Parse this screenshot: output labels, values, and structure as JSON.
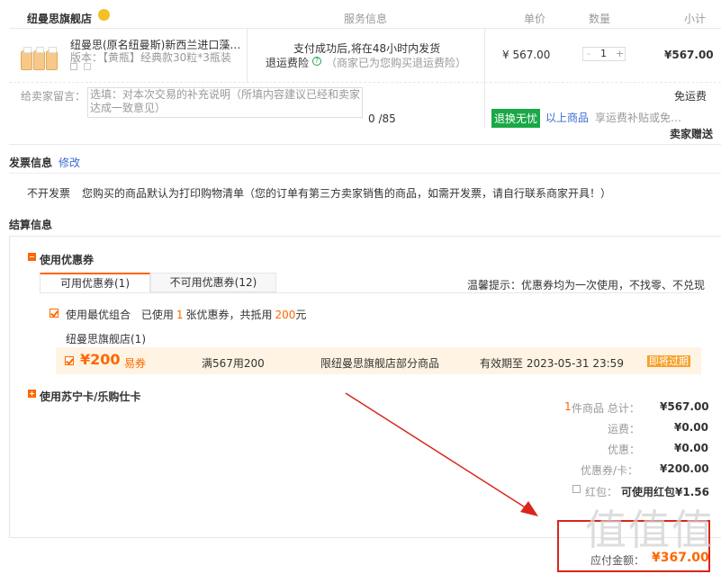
{
  "header": {
    "store": "纽曼思旗舰店",
    "service": "服务信息",
    "unit_price": "单价",
    "qty": "数量",
    "subtotal": "小计"
  },
  "product": {
    "name": "纽曼思(原名纽曼斯)新西兰进口藻…",
    "variant": "版本：【黄瓶】经典款30粒*3瓶装",
    "ship_note": "支付成功后,将在48小时内发货",
    "return_label": "退运费险",
    "return_note": "（商家已为您购买退运费险）",
    "price": "¥ 567.00",
    "qty_minus": "-",
    "qty": "1",
    "qty_plus": "+",
    "subtotal": "¥567.00"
  },
  "memo": {
    "label": "给卖家留言：",
    "placeholder": "选填：对本次交易的补充说明（所填内容建议已经和卖家达成一致意见）",
    "counter": "0 /85"
  },
  "shipping": {
    "free": "免运费",
    "badge": "退换无忧",
    "badge_link": "以上商品",
    "badge_note": "享运费补贴或免…",
    "gift": "卖家赠送"
  },
  "invoice": {
    "title": "发票信息",
    "edit": "修改",
    "type": "不开发票",
    "note": "您购买的商品默认为打印购物清单（您的订单有第三方卖家销售的商品，如需开发票，请自行联系商家开具！）"
  },
  "settle": {
    "title": "结算信息",
    "coupon_section": "使用优惠券",
    "tab_available": "可用优惠券(1)",
    "tab_unavailable": "不可用优惠券(12)",
    "tip": "温馨提示：优惠券均为一次使用，不找零、不兑现",
    "best_label": "使用最优组合",
    "best_pre": "已使用",
    "best_count": "1",
    "best_mid": "张优惠券，共抵用",
    "best_amount": "200",
    "best_unit": "元",
    "store": "纽曼思旗舰店(1)",
    "coupon": {
      "amount": "¥200",
      "type": "易券",
      "rule": "满567用200",
      "scope": "限纽曼思旗舰店部分商品",
      "expire_label": "有效期至 2023-05-31 23:59",
      "expire_tag": "即将过期"
    },
    "card_section": "使用苏宁卡/乐购仕卡"
  },
  "summary": {
    "items_count": "1",
    "items_label": "件商品 总计：",
    "items_total": "¥567.00",
    "freight_label": "运费：",
    "freight": "¥0.00",
    "discount_label": "优惠：",
    "discount": "¥0.00",
    "coupon_label": "优惠券/卡：",
    "coupon": "¥200.00",
    "redpack_label": "红包：",
    "redpack": "可使用红包¥1.56",
    "pay_label": "应付金额：",
    "pay": "¥367.00"
  },
  "colors": {
    "accent": "#ff6600",
    "green": "#1aa846",
    "link": "#3a6bd1",
    "annotation": "#d9261c"
  }
}
